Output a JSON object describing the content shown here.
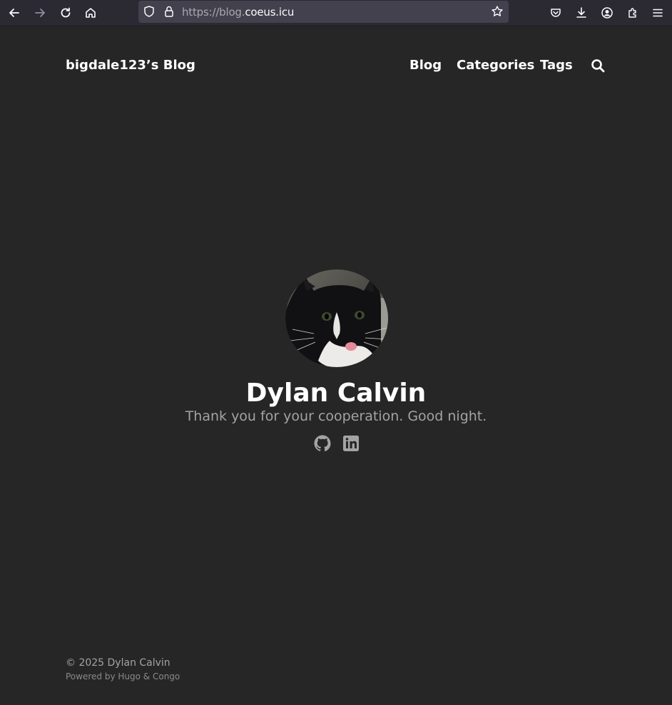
{
  "browser": {
    "url_prefix": "https://blog.",
    "url_domain": "coeus.icu",
    "icons": [
      "back-icon",
      "forward-icon",
      "reload-icon",
      "home-icon",
      "shield-icon",
      "lock-icon",
      "bookmark-star-icon",
      "pocket-icon",
      "download-icon",
      "account-icon",
      "extensions-icon",
      "menu-icon"
    ]
  },
  "header": {
    "site_title": "bigdale123’s Blog",
    "nav": [
      {
        "label": "Blog"
      },
      {
        "label": "Categories"
      },
      {
        "label": "Tags"
      }
    ]
  },
  "profile": {
    "name": "Dylan Calvin",
    "tagline": "Thank you for your cooperation. Good night.",
    "socials": [
      "github-icon",
      "linkedin-icon"
    ]
  },
  "footer": {
    "copyright": "© 2025 Dylan Calvin",
    "powered_prefix": "Powered by ",
    "hugo": "Hugo",
    "amp": " & ",
    "congo": "Congo"
  },
  "colors": {
    "page_bg": "#262626",
    "toolbar_bg": "#2b2a33",
    "urlbar_bg": "#42414d",
    "text_primary": "#ffffff",
    "text_muted": "#a3a3a3"
  }
}
